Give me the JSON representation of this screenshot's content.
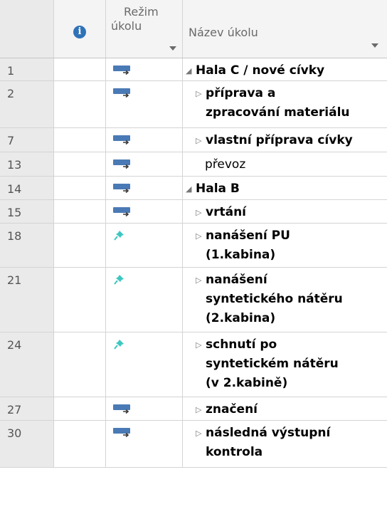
{
  "header": {
    "info_icon": "info-icon",
    "mode_line1": "Režim",
    "mode_line2": "úkolu",
    "name": "Název úkolu"
  },
  "rows": [
    {
      "id": "1",
      "mode": "auto",
      "name": "Hala C / nové cívky",
      "level": 0,
      "expander": "expanded",
      "bold": true
    },
    {
      "id": "2",
      "mode": "auto",
      "name": "příprava a\nzpracování materiálu",
      "level": 1,
      "expander": "collapsed",
      "bold": true
    },
    {
      "id": "7",
      "mode": "auto",
      "name": "vlastní příprava cívky",
      "level": 1,
      "expander": "collapsed",
      "bold": true
    },
    {
      "id": "13",
      "mode": "auto",
      "name": "převoz",
      "level": 1,
      "expander": "none",
      "bold": false
    },
    {
      "id": "14",
      "mode": "auto",
      "name": "Hala B",
      "level": 0,
      "expander": "expanded",
      "bold": true
    },
    {
      "id": "15",
      "mode": "auto",
      "name": "vrtání",
      "level": 1,
      "expander": "collapsed",
      "bold": true
    },
    {
      "id": "18",
      "mode": "manual",
      "name": "nanášení PU\n(1.kabina)",
      "level": 1,
      "expander": "collapsed",
      "bold": true
    },
    {
      "id": "21",
      "mode": "manual",
      "name": "nanášení\nsyntetického nátěru\n(2.kabina)",
      "level": 1,
      "expander": "collapsed",
      "bold": true
    },
    {
      "id": "24",
      "mode": "manual",
      "name": "schnutí po\nsyntetickém nátěru\n(v 2.kabině)",
      "level": 1,
      "expander": "collapsed",
      "bold": true
    },
    {
      "id": "27",
      "mode": "auto",
      "name": "značení",
      "level": 1,
      "expander": "collapsed",
      "bold": true
    },
    {
      "id": "30",
      "mode": "auto",
      "name": "následná výstupní\nkontrola",
      "level": 1,
      "expander": "collapsed",
      "bold": true
    }
  ],
  "icons": {
    "auto": "auto-scheduled-icon",
    "manual": "manually-scheduled-pin-icon",
    "expanded": "◢",
    "collapsed": "▷"
  },
  "colors": {
    "auto_icon": "#4a7ab5",
    "pin_icon": "#3cc7c0",
    "info_icon": "#2f72b8"
  }
}
